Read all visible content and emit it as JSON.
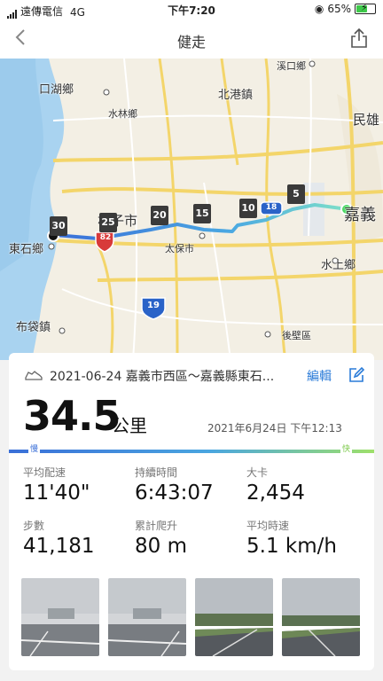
{
  "status_bar": {
    "carrier": "遠傳電信",
    "network": "4G",
    "time": "下午7:20",
    "battery": "65%",
    "battery_level": 0.65
  },
  "nav": {
    "title": "健走"
  },
  "map": {
    "labels": {
      "kouhu": "口湖鄉",
      "beigang": "北港鎮",
      "xigang": "溪口鄉",
      "minxiong": "民雄",
      "shuilin": "水林鄉",
      "puzi": "朴子市",
      "chiayi": "嘉義",
      "taibao": "太保市",
      "dongshi": "東石鄉",
      "shuishang": "水上鄉",
      "budai": "布袋鎮",
      "houbi": "後壁區"
    },
    "markers": [
      "30",
      "25",
      "20",
      "15",
      "10",
      "5"
    ],
    "shields": {
      "h82": "82",
      "h18": "18",
      "h19": "19"
    }
  },
  "activity": {
    "route_name": "2021-06-24 嘉義市西區～嘉義縣東石...",
    "edit_label": "編輯",
    "distance": "34.5",
    "distance_unit": "公里",
    "datetime": "2021年6月24日 下午12:13",
    "pace_slow": "慢",
    "pace_fast": "快",
    "stats": [
      {
        "label": "平均配速",
        "value": "11'40\""
      },
      {
        "label": "持續時間",
        "value": "6:43:07"
      },
      {
        "label": "大卡",
        "value": "2,454"
      },
      {
        "label": "步數",
        "value": "41,181"
      },
      {
        "label": "累計爬升",
        "value": "80 m"
      },
      {
        "label": "平均時速",
        "value": "5.1 km/h"
      }
    ]
  },
  "colors": {
    "route_start": "#3a6fd8",
    "route_end": "#7ee0c8",
    "start_dot": "#4cd964",
    "link": "#2a7bd8"
  }
}
